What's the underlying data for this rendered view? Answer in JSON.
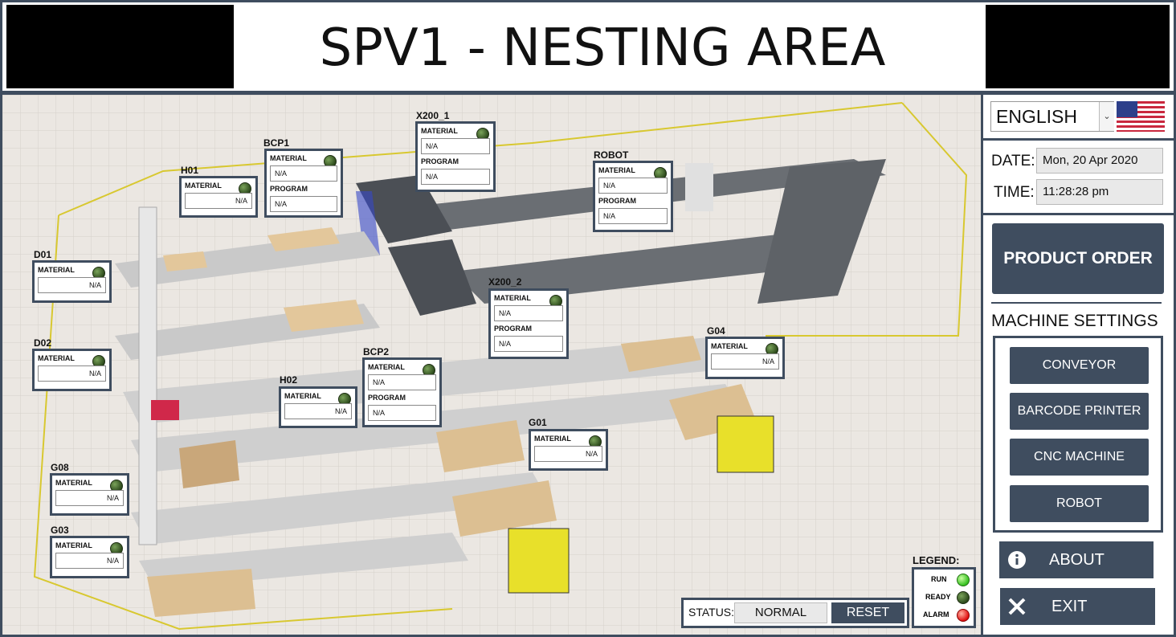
{
  "header": {
    "title": "SPV1 - NESTING AREA"
  },
  "machines": {
    "x200_1": {
      "name": "X200_1",
      "material_label": "MATERIAL",
      "material": "N/A",
      "program_label": "PROGRAM",
      "program": "N/A"
    },
    "bcp1": {
      "name": "BCP1",
      "material_label": "MATERIAL",
      "material": "N/A",
      "program_label": "PROGRAM",
      "program": "N/A"
    },
    "h01": {
      "name": "H01",
      "material_label": "MATERIAL",
      "material": "N/A"
    },
    "robot": {
      "name": "ROBOT",
      "material_label": "MATERIAL",
      "material": "N/A",
      "program_label": "PROGRAM",
      "program": "N/A"
    },
    "d01": {
      "name": "D01",
      "material_label": "MATERIAL",
      "material": "N/A"
    },
    "x200_2": {
      "name": "X200_2",
      "material_label": "MATERIAL",
      "material": "N/A",
      "program_label": "PROGRAM",
      "program": "N/A"
    },
    "d02": {
      "name": "D02",
      "material_label": "MATERIAL",
      "material": "N/A"
    },
    "g04": {
      "name": "G04",
      "material_label": "MATERIAL",
      "material": "N/A"
    },
    "bcp2": {
      "name": "BCP2",
      "material_label": "MATERIAL",
      "material": "N/A",
      "program_label": "PROGRAM",
      "program": "N/A"
    },
    "h02": {
      "name": "H02",
      "material_label": "MATERIAL",
      "material": "N/A"
    },
    "g01": {
      "name": "G01",
      "material_label": "MATERIAL",
      "material": "N/A"
    },
    "g08": {
      "name": "G08",
      "material_label": "MATERIAL",
      "material": "N/A"
    },
    "g03": {
      "name": "G03",
      "material_label": "MATERIAL",
      "material": "N/A"
    }
  },
  "sidebar": {
    "language": "ENGLISH",
    "flag_icon": "us-flag-icon",
    "date_label": "DATE:",
    "date_value": "Mon, 20 Apr 2020",
    "time_label": "TIME:",
    "time_value": "11:28:28 pm",
    "product_order": "PRODUCT ORDER",
    "machine_settings_title": "MACHINE SETTINGS",
    "machine_settings": [
      "CONVEYOR",
      "BARCODE PRINTER",
      "CNC MACHINE",
      "ROBOT"
    ],
    "about": "ABOUT",
    "exit": "EXIT"
  },
  "status": {
    "label": "STATUS:",
    "value": "NORMAL",
    "reset": "RESET"
  },
  "legend": {
    "title": "LEGEND:",
    "run": "RUN",
    "ready": "READY",
    "alarm": "ALARM"
  },
  "colors": {
    "panel_border": "#3f4d5f",
    "run": "#35c020",
    "ready": "#2d4a1c",
    "alarm": "#e01010"
  }
}
